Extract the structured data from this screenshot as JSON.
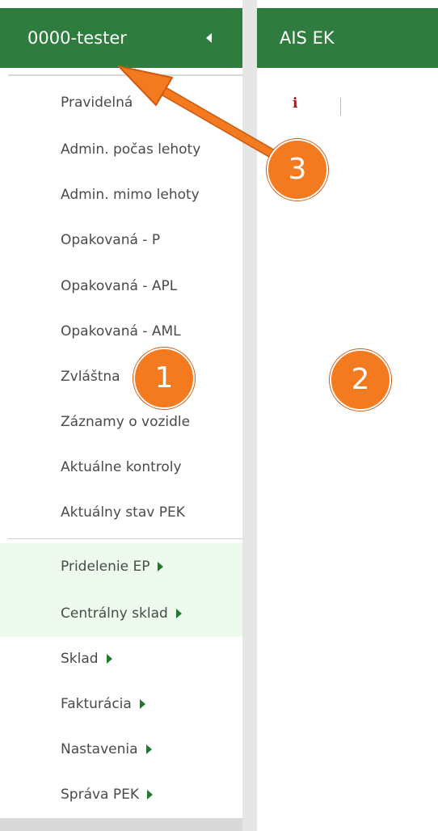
{
  "sidebar": {
    "title": "0000-tester",
    "items": [
      {
        "label": "Pravidelná"
      },
      {
        "label": "Admin. počas lehoty"
      },
      {
        "label": "Admin. mimo lehoty"
      },
      {
        "label": "Opakovaná - P"
      },
      {
        "label": "Opakovaná - APL"
      },
      {
        "label": "Opakovaná - AML"
      },
      {
        "label": "Zvláštna"
      },
      {
        "label": "Záznamy o vozidle"
      },
      {
        "label": "Aktuálne kontroly"
      },
      {
        "label": "Aktuálny stav PEK"
      }
    ],
    "submenus": [
      {
        "label": "Pridelenie EP"
      },
      {
        "label": "Centrálny sklad"
      },
      {
        "label": "Sklad"
      },
      {
        "label": "Fakturácia"
      },
      {
        "label": "Nastavenia"
      },
      {
        "label": "Správa PEK"
      }
    ]
  },
  "main": {
    "title": "AIS EK",
    "info_icon": "i"
  },
  "annotations": {
    "badge_1": "1",
    "badge_2": "2",
    "badge_3": "3"
  },
  "colors": {
    "header_green": "#2f7d3e",
    "badge_orange": "#f47a20",
    "submenu_arrow": "#1f7a2c",
    "highlight_bg": "#eefaee"
  }
}
